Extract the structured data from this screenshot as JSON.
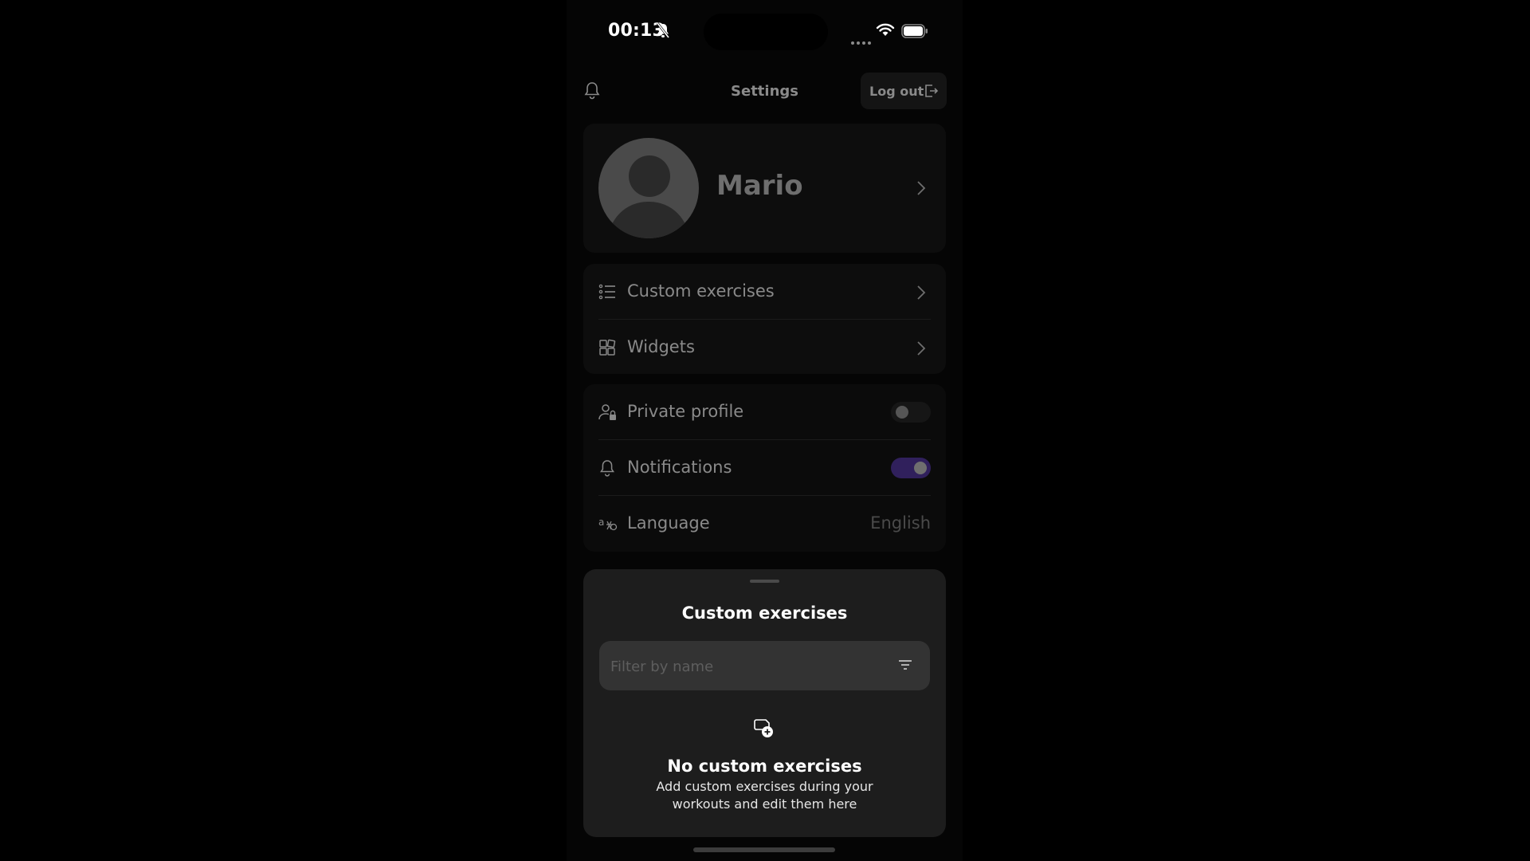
{
  "status_bar": {
    "time": "00:13"
  },
  "header": {
    "title": "Settings",
    "logout_label": "Log out"
  },
  "profile": {
    "name": "Mario"
  },
  "menu": {
    "custom_exercises": "Custom exercises",
    "widgets": "Widgets"
  },
  "preferences": {
    "private_profile": {
      "label": "Private profile",
      "enabled": false
    },
    "notifications": {
      "label": "Notifications",
      "enabled": true
    },
    "language": {
      "label": "Language",
      "value": "English"
    }
  },
  "sheet": {
    "title": "Custom exercises",
    "search_placeholder": "Filter by name",
    "empty_title": "No custom exercises",
    "empty_description": "Add custom exercises during your workouts and edit them here"
  },
  "colors": {
    "accent_toggle_on": "#30205c",
    "sheet_background": "#1d1d1d"
  },
  "icons": [
    "bell-off-icon",
    "wifi-icon",
    "battery-icon",
    "bell-icon",
    "logout-icon",
    "chevron-right-icon",
    "list-icon",
    "widgets-icon",
    "user-lock-icon",
    "language-icon",
    "filter-icon",
    "add-exercise-icon"
  ]
}
